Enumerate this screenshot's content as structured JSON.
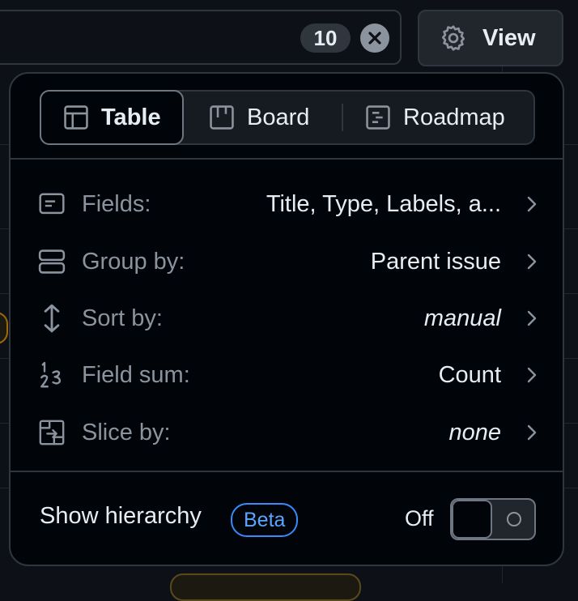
{
  "filter": {
    "count": "10"
  },
  "view_button": {
    "label": "View"
  },
  "layouts": [
    {
      "label": "Table",
      "icon": "table-icon",
      "active": true
    },
    {
      "label": "Board",
      "icon": "board-icon",
      "active": false
    },
    {
      "label": "Roadmap",
      "icon": "roadmap-icon",
      "active": false
    }
  ],
  "options": [
    {
      "label": "Fields:",
      "value": "Title, Type, Labels, a...",
      "icon": "fields-icon",
      "italic": false
    },
    {
      "label": "Group by:",
      "value": "Parent issue",
      "icon": "group-by-icon",
      "italic": false
    },
    {
      "label": "Sort by:",
      "value": "manual",
      "icon": "sort-icon",
      "italic": true
    },
    {
      "label": "Field sum:",
      "value": "Count",
      "icon": "field-sum-icon",
      "italic": false
    },
    {
      "label": "Slice by:",
      "value": "none",
      "icon": "slice-icon",
      "italic": true
    }
  ],
  "hierarchy": {
    "label": "Show hierarchy",
    "badge": "Beta",
    "state_label": "Off",
    "enabled": false
  },
  "colors": {
    "background": "#0d1117",
    "popover": "#010409",
    "border": "#30363d",
    "muted_text": "#8b949e",
    "accent_blue": "#58a6ff"
  }
}
